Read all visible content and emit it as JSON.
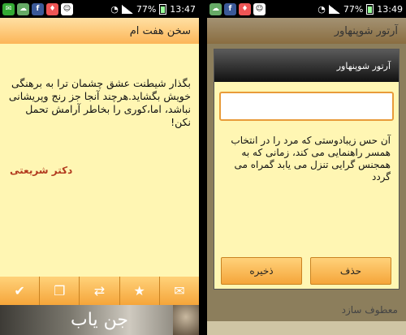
{
  "left": {
    "status": {
      "battery": "77%",
      "time": "13:47"
    },
    "title": "سخن هفت ام",
    "poem": "بگذار شیطنت عشق چشمان ترا به برهنگی خویش بگشاید.هرچند آنجا جز رنج وپریشانی نباشد، اما،کوری را بخاطر آرامش تحمل نکن!",
    "author": "دکتر شریعتی",
    "toolbar": {
      "check_icon": "✔",
      "copy_icon": "❐",
      "shuffle_icon": "⇄",
      "star_icon": "★",
      "mail_icon": "✉"
    },
    "banner_text": "جن یاب"
  },
  "right": {
    "status": {
      "battery": "77%",
      "time": "13:49"
    },
    "title": "آرتور شوپنهاور",
    "dialog": {
      "title": "آرتور شوپنهاور",
      "input_value": "",
      "text": "آن حس زیبادوستی که مرد را در انتخاب همسر راهنمایی می کند، زمانی که به همجنس گرایی تنزل می یابد گمراه می گردد",
      "delete_label": "حذف",
      "save_label": "ذخیره"
    },
    "bg_line": "معطوف سازد"
  },
  "colors": {
    "accent": "#f5a53a",
    "paper": "#fff6b3",
    "author": "#b23b1f"
  }
}
